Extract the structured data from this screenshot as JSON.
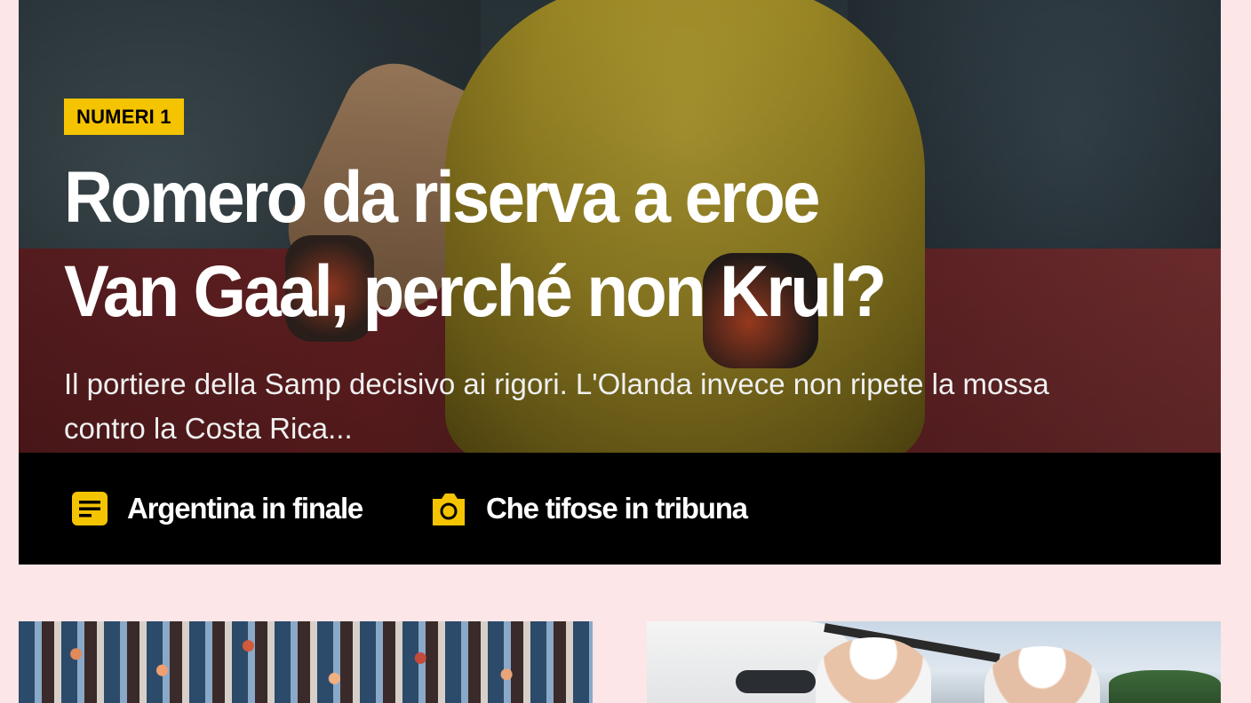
{
  "hero": {
    "kicker": "NUMERI 1",
    "headline_line1": "Romero da riserva a eroe",
    "headline_line2": "Van Gaal, perché non Krul?",
    "subtitle": "Il portiere della Samp decisivo ai rigori. L'Olanda invece non ripete la mossa contro la Costa Rica...",
    "image_desc": "goalkeeper-photo"
  },
  "related": {
    "items": [
      {
        "label": "Argentina in finale",
        "icon": "article-icon"
      },
      {
        "label": "Che tifose in tribuna",
        "icon": "camera-icon"
      }
    ]
  },
  "cards": {
    "left_image": "stadium-crowd-photo",
    "right_image": "pope-plane-photo"
  },
  "colors": {
    "accent": "#f5c400",
    "background": "#fce6e8",
    "bar": "#000000",
    "text": "#ffffff"
  }
}
